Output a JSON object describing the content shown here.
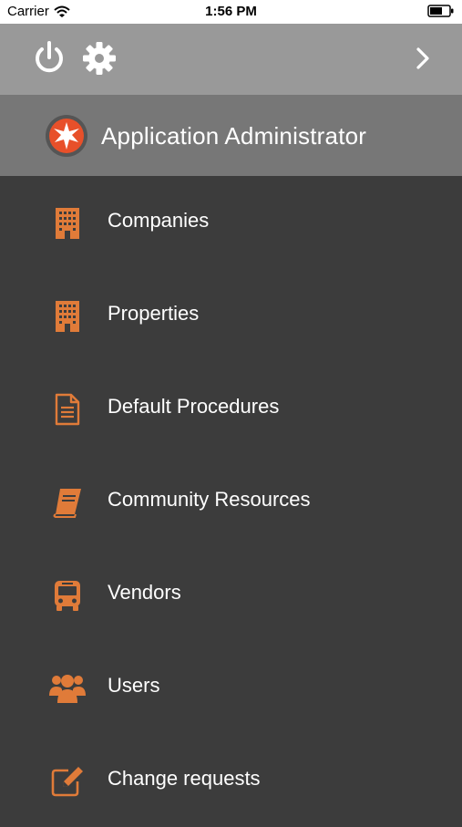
{
  "status_bar": {
    "carrier": "Carrier",
    "time": "1:56 PM"
  },
  "toolbar": {
    "icons": [
      "power-icon",
      "settings-gear-icon",
      "chevron-right-icon"
    ]
  },
  "user": {
    "name": "Application Administrator"
  },
  "colors": {
    "accent": "#e07b39",
    "toolbar_bg": "#999999",
    "user_bar_bg": "#777777",
    "menu_bg": "#3c3c3c"
  },
  "menu": {
    "items": [
      {
        "label": "Companies",
        "icon": "building-icon"
      },
      {
        "label": "Properties",
        "icon": "building-icon"
      },
      {
        "label": "Default Procedures",
        "icon": "document-icon"
      },
      {
        "label": "Community Resources",
        "icon": "book-icon"
      },
      {
        "label": "Vendors",
        "icon": "bus-icon"
      },
      {
        "label": "Users",
        "icon": "users-icon"
      },
      {
        "label": "Change requests",
        "icon": "edit-icon"
      }
    ]
  }
}
